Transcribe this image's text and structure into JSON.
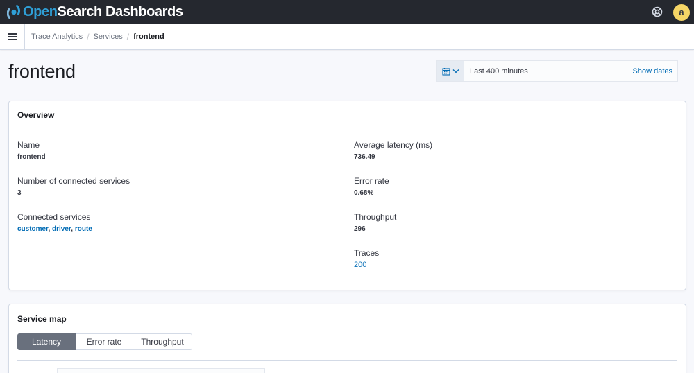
{
  "header": {
    "logo_open": "Open",
    "logo_rest": "Search Dashboards",
    "help_icon": "help-icon",
    "avatar_initial": "a",
    "avatar_color": "#f5d566"
  },
  "breadcrumbs": {
    "menu_icon": "hamburger-menu-icon",
    "items": [
      "Trace Analytics",
      "Services",
      "frontend"
    ]
  },
  "page": {
    "title": "frontend"
  },
  "date_picker": {
    "icon": "calendar-icon",
    "range": "Last 400 minutes",
    "show_dates": "Show dates"
  },
  "overview": {
    "title": "Overview",
    "left": {
      "name_label": "Name",
      "name_value": "frontend",
      "connected_count_label": "Number of connected services",
      "connected_count_value": "3",
      "connected_label": "Connected services",
      "connected_services": [
        "customer",
        "driver",
        "route"
      ]
    },
    "right": {
      "latency_label": "Average latency (ms)",
      "latency_value": "736.49",
      "error_label": "Error rate",
      "error_value": "0.68%",
      "throughput_label": "Throughput",
      "throughput_value": "296",
      "traces_label": "Traces",
      "traces_value": "200"
    }
  },
  "service_map": {
    "title": "Service map",
    "tabs": [
      "Latency",
      "Error rate",
      "Throughput"
    ],
    "selected": "Latency"
  },
  "colors": {
    "header_bg": "#25282f",
    "link": "#006bb4",
    "logo_accent": "#2f9fd6",
    "active_tab": "#69707d"
  }
}
